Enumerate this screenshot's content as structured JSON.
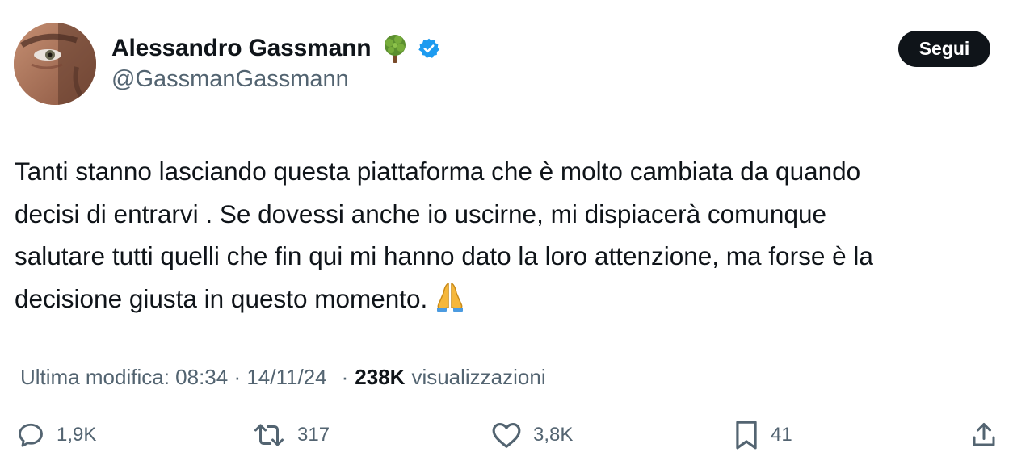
{
  "author": {
    "display_name": "Alessandro Gassmann",
    "handle": "@GassmanGassmann",
    "badge_icon": "tree-emoji-icon",
    "verified_icon": "verified-badge-icon",
    "verified_color": "#1d9bf0"
  },
  "follow_button": {
    "label": "Segui"
  },
  "tweet": {
    "lines": [
      "Tanti stanno lasciando questa piattaforma che è molto cambiata da quando",
      "decisi di entrarvi . Se dovessi anche io uscirne, mi dispiacerà comunque",
      "salutare tutti quelli che fin qui mi hanno dato la loro attenzione, ma forse è la",
      "decisione giusta in questo momento."
    ],
    "trailing_emoji_icon": "folded-hands-icon"
  },
  "meta": {
    "edited_label": "Ultima modifica: 08:34 · 14/11/24",
    "separator": "·",
    "views_count": "238K",
    "views_label": "visualizzazioni"
  },
  "actions": {
    "reply_count": "1,9K",
    "repost_count": "317",
    "like_count": "3,8K",
    "bookmark_count": "41",
    "share_icon": "share-icon"
  },
  "colors": {
    "text_primary": "#0f1419",
    "text_secondary": "#536471",
    "button_bg": "#0f1419",
    "button_text": "#ffffff"
  }
}
